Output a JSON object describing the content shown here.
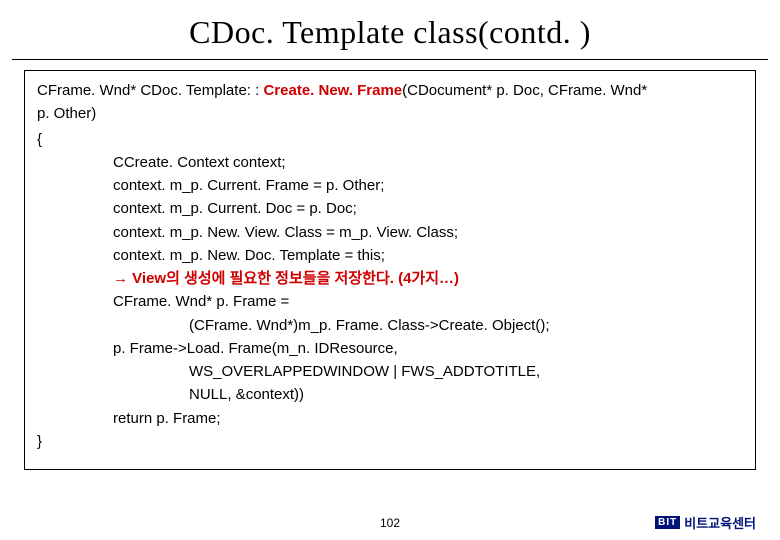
{
  "title": "CDoc. Template class(contd. )",
  "code": {
    "sig_part1": "CFrame. Wnd* CDoc. Template: : ",
    "sig_red": "Create. New. Frame",
    "sig_part2": "(CDocument* p. Doc, CFrame. Wnd*",
    "sig_line2": "p. Other)",
    "brace_open": "{",
    "body1": "CCreate. Context context;",
    "body2": "context. m_p. Current. Frame = p. Other;",
    "body3": "context. m_p. Current. Doc = p. Doc;",
    "body4": "context. m_p. New. View. Class = m_p. View. Class;",
    "body5": "context. m_p. New. Doc. Template = this;",
    "body6_arrow": "→",
    "body6_red": " View의 생성에 필요한 정보들을 저장한다. (4가지…)",
    "body7": "CFrame. Wnd* p. Frame =",
    "body8": "(CFrame. Wnd*)m_p. Frame. Class->Create. Object();",
    "body9": "p. Frame->Load. Frame(m_n. IDResource,",
    "body10": "WS_OVERLAPPEDWINDOW | FWS_ADDTOTITLE,",
    "body11": "NULL, &context))",
    "body12": "return p. Frame;",
    "brace_close": "}"
  },
  "page_number": "102",
  "brand_logo": "BIT",
  "brand_text": "비트교육센터"
}
